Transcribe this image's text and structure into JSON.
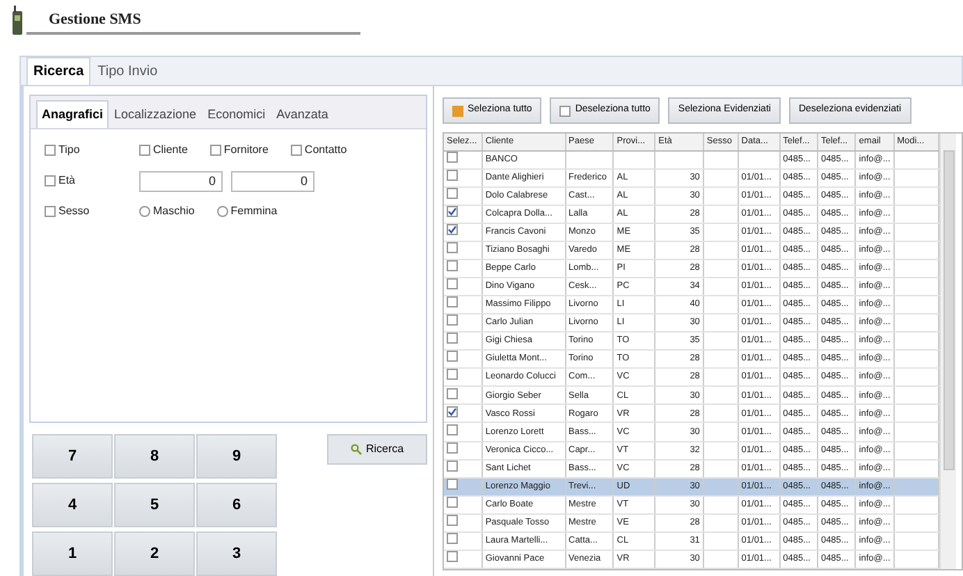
{
  "app": {
    "title": "Gestione SMS"
  },
  "tabs": [
    {
      "label": "Ricerca",
      "selected": true
    },
    {
      "label": "Tipo Invio",
      "selected": false
    }
  ],
  "filter_tabs": [
    {
      "label": "Anagrafici",
      "selected": true
    },
    {
      "label": "Localizzazione",
      "selected": false
    },
    {
      "label": "Economici",
      "selected": false
    },
    {
      "label": "Avanzata",
      "selected": false
    }
  ],
  "filters": [
    {
      "kind": "check",
      "label": "Tipo",
      "checked": false,
      "options": [
        {
          "kind": "check",
          "label": "Cliente",
          "checked": false
        },
        {
          "kind": "check",
          "label": "Fornitore",
          "checked": false
        },
        {
          "kind": "check",
          "label": "Contatto",
          "checked": false
        }
      ]
    },
    {
      "kind": "check",
      "label": "Età",
      "checked": false,
      "options": [
        {
          "kind": "spin",
          "value": "0"
        },
        {
          "kind": "spin",
          "value": "0"
        }
      ]
    },
    {
      "kind": "check",
      "label": "Sesso",
      "checked": false,
      "options": [
        {
          "kind": "radio",
          "label": "Maschio",
          "checked": false
        },
        {
          "kind": "radio",
          "label": "Femmina",
          "checked": false
        }
      ]
    }
  ],
  "keypad": [
    "7",
    "8",
    "9",
    "4",
    "5",
    "6",
    "1",
    "2",
    "3"
  ],
  "search_button": "Ricerca",
  "toolbar": [
    {
      "label": "Seleziona tutto",
      "icon": true
    },
    {
      "label": "Deseleziona tutto",
      "icon": true
    },
    {
      "label": "Seleziona Evidenziati",
      "icon": false
    },
    {
      "label": "Deseleziona evidenziati",
      "icon": false
    }
  ],
  "table": {
    "columns": [
      "Selez...",
      "Cliente",
      "Paese",
      "Provi...",
      "Età",
      "Sesso",
      "Data...",
      "Telef...",
      "Telef...",
      "email",
      "Modi..."
    ],
    "rows": [
      {
        "checked": false,
        "selected": false,
        "cells": [
          "",
          "BANCO",
          "",
          "",
          "",
          "",
          "",
          "0485...",
          "0485...",
          "info@...",
          ""
        ]
      },
      {
        "checked": false,
        "selected": false,
        "cells": [
          "",
          "Dante Alighieri",
          "Frederico",
          "AL",
          "30",
          "",
          "01/01...",
          "0485...",
          "0485...",
          "info@...",
          ""
        ]
      },
      {
        "checked": false,
        "selected": false,
        "cells": [
          "",
          "Dolo Calabrese",
          "Cast...",
          "AL",
          "30",
          "",
          "01/01...",
          "0485...",
          "0485...",
          "info@...",
          ""
        ]
      },
      {
        "checked": true,
        "selected": false,
        "cells": [
          "",
          "Colcapra Dolla...",
          "Lalla",
          "AL",
          "28",
          "",
          "01/01...",
          "0485...",
          "0485...",
          "info@...",
          ""
        ]
      },
      {
        "checked": true,
        "selected": false,
        "cells": [
          "",
          "Francis Cavoni",
          "Monzo",
          "ME",
          "35",
          "",
          "01/01...",
          "0485...",
          "0485...",
          "info@...",
          ""
        ]
      },
      {
        "checked": false,
        "selected": false,
        "cells": [
          "",
          "Tiziano Bosaghi",
          "Varedo",
          "ME",
          "28",
          "",
          "01/01...",
          "0485...",
          "0485...",
          "info@...",
          ""
        ]
      },
      {
        "checked": false,
        "selected": false,
        "cells": [
          "",
          "Beppe Carlo",
          "Lomb...",
          "PI",
          "28",
          "",
          "01/01...",
          "0485...",
          "0485...",
          "info@...",
          ""
        ]
      },
      {
        "checked": false,
        "selected": false,
        "cells": [
          "",
          "Dino Vigano",
          "Cesk...",
          "PC",
          "34",
          "",
          "01/01...",
          "0485...",
          "0485...",
          "info@...",
          ""
        ]
      },
      {
        "checked": false,
        "selected": false,
        "cells": [
          "",
          "Massimo Filippo",
          "Livorno",
          "LI",
          "40",
          "",
          "01/01...",
          "0485...",
          "0485...",
          "info@...",
          ""
        ]
      },
      {
        "checked": false,
        "selected": false,
        "cells": [
          "",
          "Carlo Julian",
          "Livorno",
          "LI",
          "30",
          "",
          "01/01...",
          "0485...",
          "0485...",
          "info@...",
          ""
        ]
      },
      {
        "checked": false,
        "selected": false,
        "cells": [
          "",
          "Gigi Chiesa",
          "Torino",
          "TO",
          "35",
          "",
          "01/01...",
          "0485...",
          "0485...",
          "info@...",
          ""
        ]
      },
      {
        "checked": false,
        "selected": false,
        "cells": [
          "",
          "Giuletta Mont...",
          "Torino",
          "TO",
          "28",
          "",
          "01/01...",
          "0485...",
          "0485...",
          "info@...",
          ""
        ]
      },
      {
        "checked": false,
        "selected": false,
        "cells": [
          "",
          "Leonardo Colucci",
          "Com...",
          "VC",
          "28",
          "",
          "01/01...",
          "0485...",
          "0485...",
          "info@...",
          ""
        ]
      },
      {
        "checked": false,
        "selected": false,
        "cells": [
          "",
          "Giorgio Seber",
          "Sella",
          "CL",
          "30",
          "",
          "01/01...",
          "0485...",
          "0485...",
          "info@...",
          ""
        ]
      },
      {
        "checked": true,
        "selected": false,
        "cells": [
          "",
          "Vasco Rossi",
          "Rogaro",
          "VR",
          "28",
          "",
          "01/01...",
          "0485...",
          "0485...",
          "info@...",
          ""
        ]
      },
      {
        "checked": false,
        "selected": false,
        "cells": [
          "",
          "Lorenzo Lorett",
          "Bass...",
          "VC",
          "30",
          "",
          "01/01...",
          "0485...",
          "0485...",
          "info@...",
          ""
        ]
      },
      {
        "checked": false,
        "selected": false,
        "cells": [
          "",
          "Veronica Cicco...",
          "Capr...",
          "VT",
          "32",
          "",
          "01/01...",
          "0485...",
          "0485...",
          "info@...",
          ""
        ]
      },
      {
        "checked": false,
        "selected": false,
        "cells": [
          "",
          "Sant Lichet",
          "Bass...",
          "VC",
          "28",
          "",
          "01/01...",
          "0485...",
          "0485...",
          "info@...",
          ""
        ]
      },
      {
        "checked": false,
        "selected": true,
        "cells": [
          "",
          "Lorenzo Maggio",
          "Trevi...",
          "UD",
          "30",
          "",
          "01/01...",
          "0485...",
          "0485...",
          "info@...",
          ""
        ]
      },
      {
        "checked": false,
        "selected": false,
        "cells": [
          "",
          "Carlo Boate",
          "Mestre",
          "VT",
          "30",
          "",
          "01/01...",
          "0485...",
          "0485...",
          "info@...",
          ""
        ]
      },
      {
        "checked": false,
        "selected": false,
        "cells": [
          "",
          "Pasquale Tosso",
          "Mestre",
          "VE",
          "28",
          "",
          "01/01...",
          "0485...",
          "0485...",
          "info@...",
          ""
        ]
      },
      {
        "checked": false,
        "selected": false,
        "cells": [
          "",
          "Laura Martelli...",
          "Catta...",
          "CL",
          "31",
          "",
          "01/01...",
          "0485...",
          "0485...",
          "info@...",
          ""
        ]
      },
      {
        "checked": false,
        "selected": false,
        "cells": [
          "",
          "Giovanni Pace",
          "Venezia",
          "VR",
          "30",
          "",
          "01/01...",
          "0485...",
          "0485...",
          "info@...",
          ""
        ]
      }
    ]
  }
}
